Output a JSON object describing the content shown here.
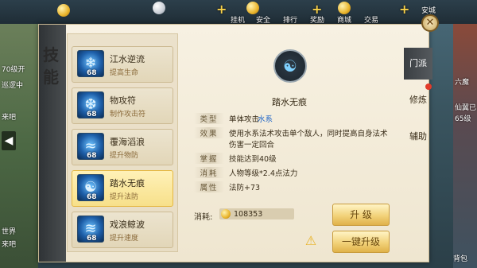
{
  "hud": {
    "top_items": [
      "挂机",
      "安全",
      "排行",
      "奖励",
      "商城",
      "交易",
      "安城"
    ],
    "left_texts": [
      "70级开",
      "巡逻中",
      "来吧",
      "世界",
      "来吧"
    ],
    "right_texts": [
      "六魔",
      "仙翼已",
      "65级",
      "背包"
    ]
  },
  "panel": {
    "title": "技能",
    "tabs": [
      {
        "label": "门派",
        "active": true
      },
      {
        "label": "修炼",
        "active": false,
        "badge": true
      },
      {
        "label": "辅助",
        "active": false
      }
    ]
  },
  "skills": [
    {
      "name": "江水逆流",
      "desc": "提高生命",
      "level": "68",
      "selected": false
    },
    {
      "name": "物攻符",
      "desc": "制作攻击符",
      "level": "68",
      "selected": false
    },
    {
      "name": "覆海滔浪",
      "desc": "提升物防",
      "level": "68",
      "selected": false
    },
    {
      "name": "踏水无痕",
      "desc": "提升法防",
      "level": "68",
      "selected": true
    },
    {
      "name": "戏浪鲸波",
      "desc": "提升速度",
      "level": "68",
      "selected": false
    }
  ],
  "detail": {
    "name": "踏水无痕",
    "attrs": [
      {
        "tag": "类型",
        "value": "单体攻击",
        "extra": "水系"
      },
      {
        "tag": "效果",
        "value": "使用水系法术攻击单个敌人，同时提高自身法术",
        "value2": "伤害一定回合"
      },
      {
        "tag": "掌握",
        "value": "技能达到40级"
      },
      {
        "tag": "消耗",
        "value": "人物等级*2.4点法力"
      },
      {
        "tag": "属性",
        "value": "法防+73"
      }
    ],
    "cost_label": "消耗:",
    "cost_value": "108353"
  },
  "buttons": {
    "upgrade": "升 级",
    "upgrade_all": "一键升级"
  },
  "colors": {
    "accent": "#f2d27a",
    "water_blue": "#2468c8",
    "tab_dark": "#3a3e42"
  }
}
